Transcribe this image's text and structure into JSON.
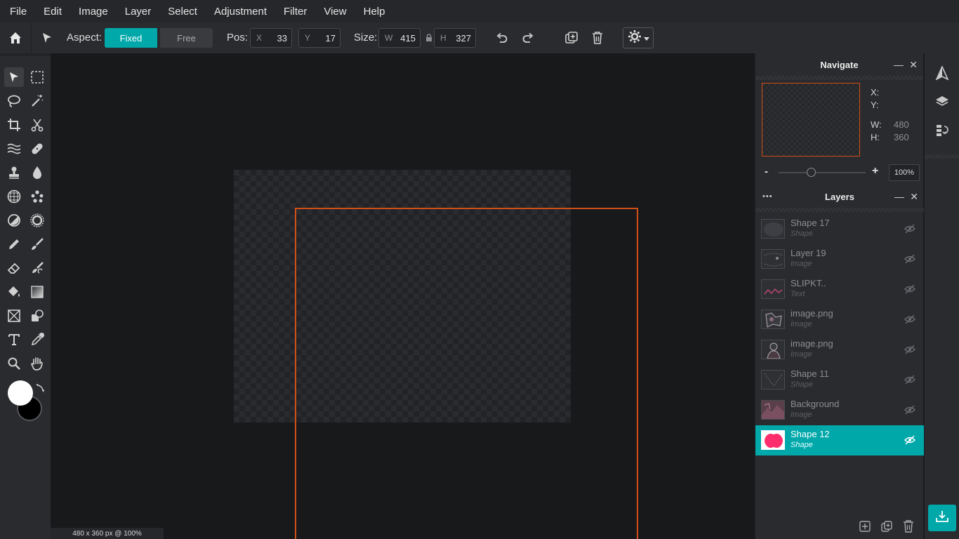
{
  "menu": [
    "File",
    "Edit",
    "Image",
    "Layer",
    "Select",
    "Adjustment",
    "Filter",
    "View",
    "Help"
  ],
  "toolbar": {
    "aspect_label": "Aspect:",
    "fixed_label": "Fixed",
    "free_label": "Free",
    "pos_label": "Pos:",
    "x_prefix": "X",
    "x_value": "33",
    "y_prefix": "Y",
    "y_value": "17",
    "size_label": "Size:",
    "w_prefix": "W",
    "w_value": "415",
    "h_prefix": "H",
    "h_value": "327"
  },
  "status": "480 x 360 px @ 100%",
  "navigate": {
    "title": "Navigate",
    "x_label": "X:",
    "y_label": "Y:",
    "w_label": "W:",
    "w_value": "480",
    "h_label": "H:",
    "h_value": "360",
    "zoom_minus": "-",
    "zoom_plus": "+",
    "zoom_value": "100%"
  },
  "layers": {
    "title": "Layers",
    "dots": "•••",
    "items": [
      {
        "name": "Shape 17",
        "type": "Shape"
      },
      {
        "name": "Layer 19",
        "type": "Image"
      },
      {
        "name": "SLIPKT..",
        "type": "Text"
      },
      {
        "name": "image.png",
        "type": "Image"
      },
      {
        "name": "image.png",
        "type": "Image"
      },
      {
        "name": "Shape 11",
        "type": "Shape"
      },
      {
        "name": "Background",
        "type": "Image"
      },
      {
        "name": "Shape 12",
        "type": "Shape"
      }
    ]
  },
  "colors": {
    "accent": "#00a8aa",
    "selection": "#d24e18",
    "foreground": "#ffffff",
    "background": "#000000",
    "shape12": "#ff2d6b"
  }
}
